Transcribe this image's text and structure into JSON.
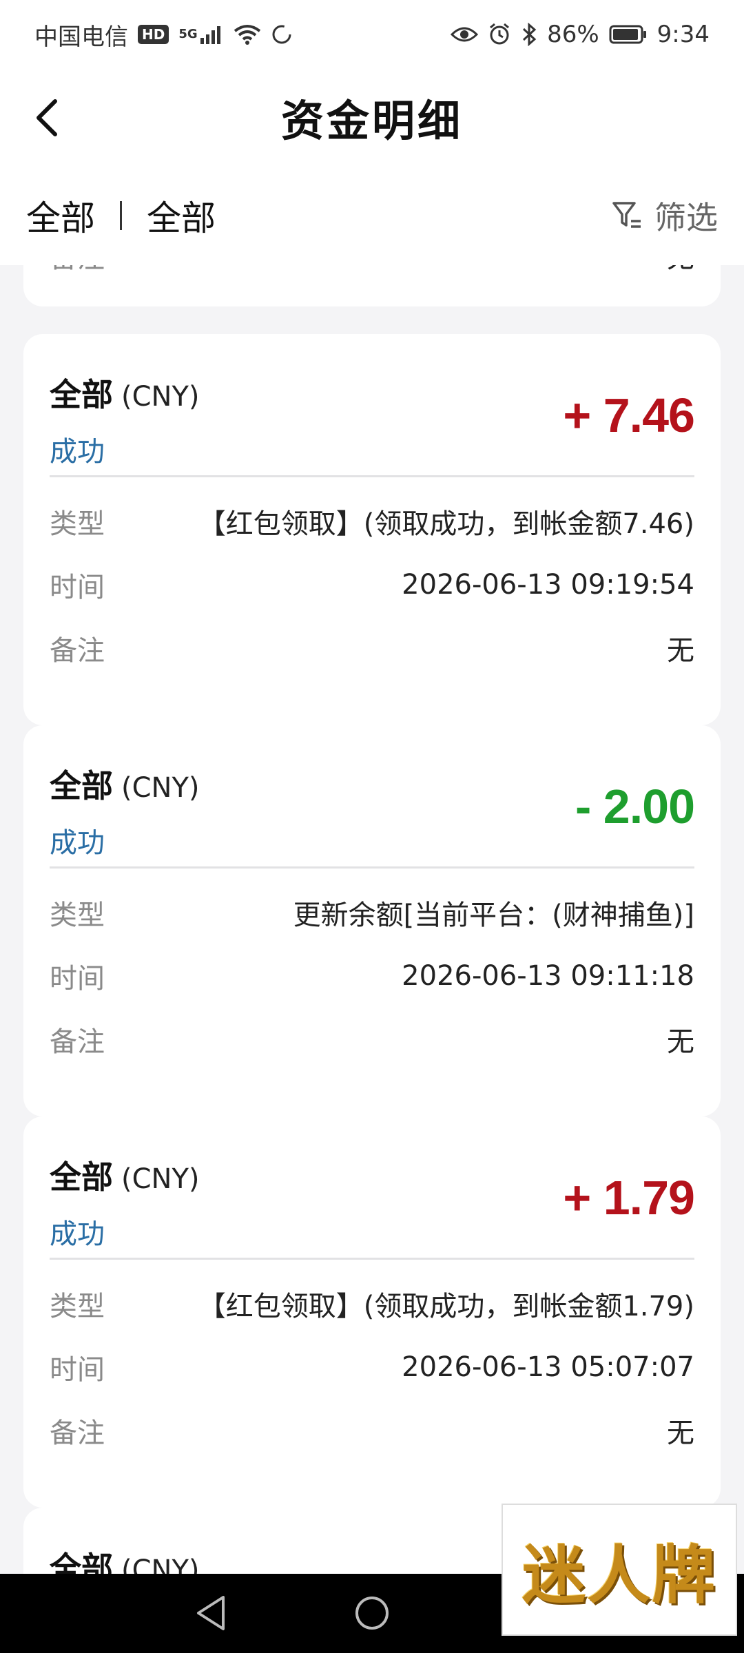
{
  "status_bar": {
    "carrier": "中国电信",
    "hd_badge": "HD",
    "network": "5G",
    "battery": "86%",
    "time": "9:34"
  },
  "header": {
    "title": "资金明细"
  },
  "filter": {
    "category": "全部",
    "status": "全部",
    "filter_label": "筛选"
  },
  "partial_card": {
    "label": "备注",
    "value": "无"
  },
  "labels": {
    "type": "类型",
    "time": "时间",
    "remark": "备注"
  },
  "records": [
    {
      "account": "全部",
      "currency": "(CNY)",
      "status": "成功",
      "amount": "+ 7.46",
      "direction": "income",
      "type": "【红包领取】(领取成功，到帐金额7.46)",
      "time": "2026-06-13 09:19:54",
      "remark": "无"
    },
    {
      "account": "全部",
      "currency": "(CNY)",
      "status": "成功",
      "amount": "- 2.00",
      "direction": "expense",
      "type": "更新余额[当前平台：(财神捕鱼)]",
      "time": "2026-06-13 09:11:18",
      "remark": "无"
    },
    {
      "account": "全部",
      "currency": "(CNY)",
      "status": "成功",
      "amount": "+ 1.79",
      "direction": "income",
      "type": "【红包领取】(领取成功，到帐金额1.79)",
      "time": "2026-06-13 05:07:07",
      "remark": "无"
    },
    {
      "account": "全部",
      "currency": "(CNY)"
    }
  ],
  "watermark": "迷人牌",
  "colors": {
    "income": "#b4121b",
    "expense": "#1e9e2e",
    "status": "#2a6ea5"
  }
}
